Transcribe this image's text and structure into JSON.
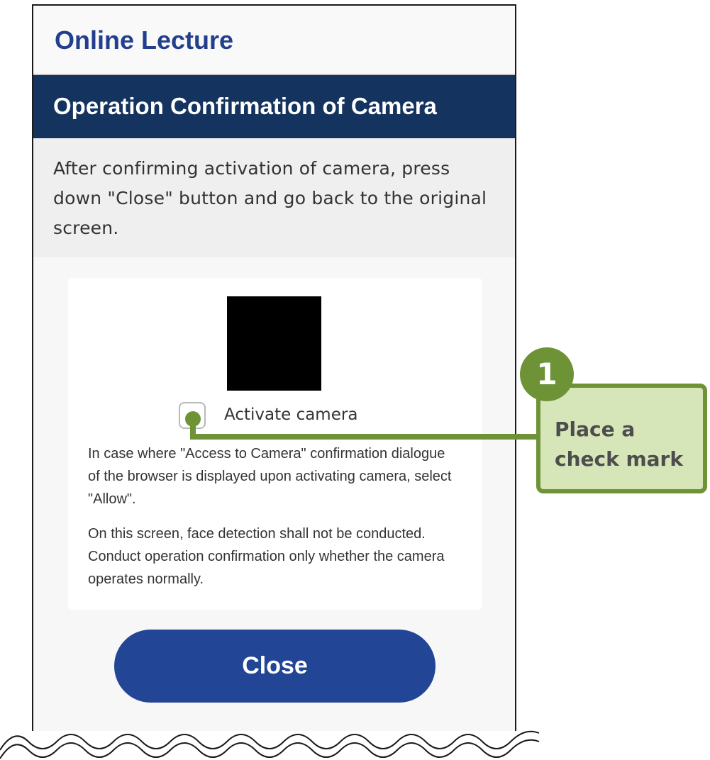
{
  "app": {
    "title": "Online Lecture"
  },
  "section": {
    "title": "Operation Confirmation of Camera",
    "instruction": "After confirming activation of camera, press down \"Close\" button and go back to the original screen."
  },
  "camera": {
    "checkbox_label": "Activate camera",
    "checkbox_checked": false,
    "note_1": "In case where \"Access to Camera\" confirmation dialogue of the browser is displayed upon activating camera, select \"Allow\".",
    "note_2": "On this screen, face detection shall not be conducted. Conduct operation confirmation only whether the camera operates normally."
  },
  "actions": {
    "close_label": "Close"
  },
  "annotation": {
    "step_number": "1",
    "text": "Place a\ncheck mark",
    "color": "#6e9337",
    "fill": "#d7e6b9"
  },
  "colors": {
    "header_bar": "#14335f",
    "title_blue": "#223f8e",
    "button_blue": "#224596"
  }
}
